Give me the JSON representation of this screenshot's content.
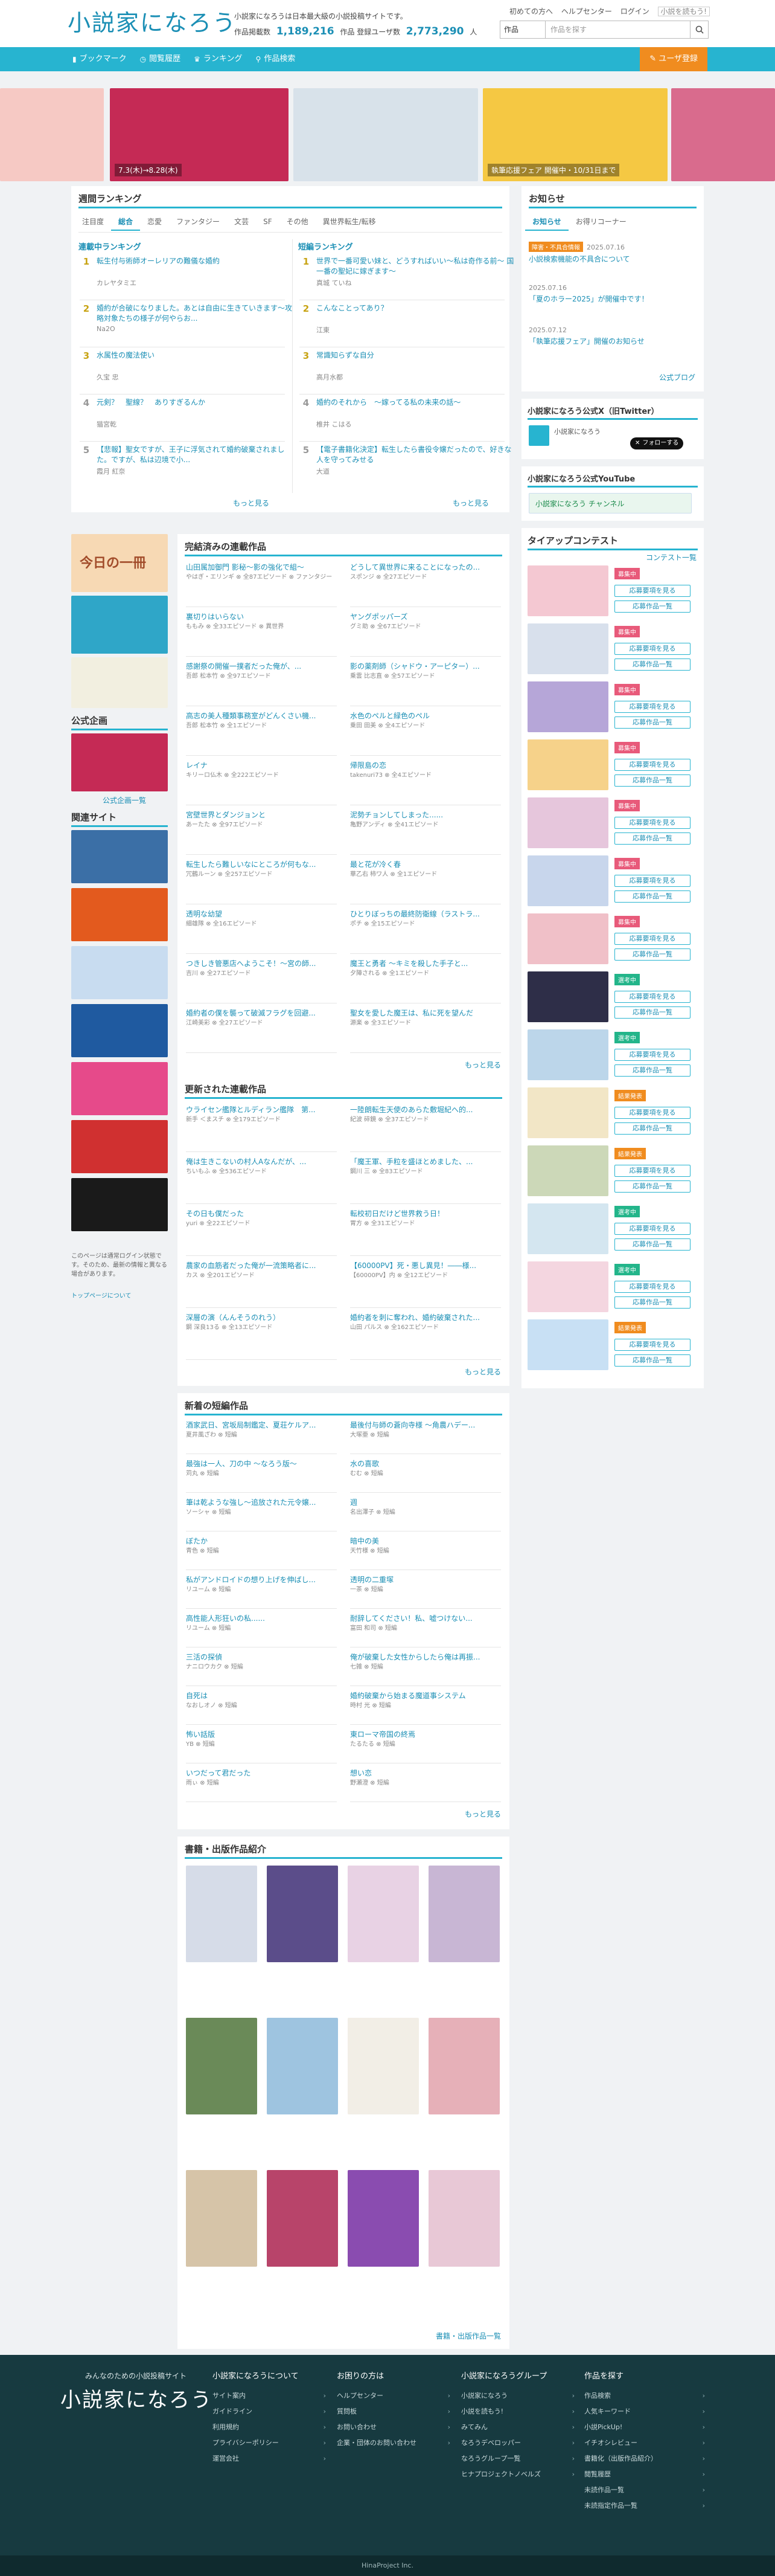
{
  "header": {
    "logo": "小説家になろう",
    "site_desc": "小説家になろうは日本最大級の小説投稿サイトです。",
    "stats_label_works": "作品掲載数",
    "stats_works": "1,189,216",
    "stats_label_users": "作品 登録ユーザ数",
    "stats_users": "2,773,290",
    "stats_unit": "人",
    "user_links": [
      "初めての方へ",
      "ヘルプセンター",
      "ログイン"
    ],
    "sub_logo": "小説を読もう!",
    "search_select": "作品",
    "search_placeholder": "作品を探す"
  },
  "nav": {
    "items": [
      "ブックマーク",
      "閲覧履歴",
      "ランキング",
      "作品検索"
    ],
    "register": "ユーザ登録"
  },
  "banners": [
    {
      "label": "",
      "color": "#f6c9c4"
    },
    {
      "label": "7.3(木)→8.28(木)",
      "color": "#c52a55"
    },
    {
      "label": "",
      "color": "#d8e2ea"
    },
    {
      "label": "執筆応援フェア 開催中・10/31日まで",
      "color": "#f5c843"
    },
    {
      "label": "",
      "color": "#f2efe0"
    },
    {
      "label": "",
      "color": "#d96b8d"
    }
  ],
  "ranking": {
    "title": "週間ランキング",
    "tabs": [
      "注目度",
      "総合",
      "恋愛",
      "ファンタジー",
      "文芸",
      "SF",
      "その他",
      "異世界転生/転移"
    ],
    "active_tab": 1,
    "col_left_title": "連載中ランキング",
    "col_right_title": "短編ランキング",
    "left": [
      {
        "no": "1",
        "title": "転生付与術師オーレリアの難儀な婚約",
        "author": "カレヤタミエ"
      },
      {
        "no": "2",
        "title": "婚約が合破になりました。あとは自由に生きていきます〜攻略対象たちの様子が何やらお...",
        "author": "Na2O"
      },
      {
        "no": "3",
        "title": "水属性の魔法使い",
        "author": "久宝 忠"
      },
      {
        "no": "4",
        "title": "元剣？　聖線？　ありすぎるんか",
        "author": "猫宮乾"
      },
      {
        "no": "5",
        "title": "【悲報】聖女ですが、王子に浮気されて婚約破棄されました。ですが、私は辺境で小...",
        "author": "霞月 紅奈"
      }
    ],
    "right": [
      {
        "no": "1",
        "title": "世界で一番可愛い妹と、どうすればいい〜私は奇作る前〜 国一番の聖妃に嫁ぎます〜",
        "author": "真城 ていね"
      },
      {
        "no": "2",
        "title": "こんなことってあり？",
        "author": "江東"
      },
      {
        "no": "3",
        "title": "常識知らずな自分",
        "author": "高月水都"
      },
      {
        "no": "4",
        "title": "婚約のそれから　〜嫁ってる私の未来の話〜",
        "author": "椎井 こはる"
      },
      {
        "no": "5",
        "title": "【電子書籍化決定】転生したら書役令嬢だったので、好きな人を守ってみせる",
        "author": "大道"
      }
    ],
    "more": "もっと見る"
  },
  "news": {
    "title": "お知らせ",
    "tabs": [
      "お知らせ",
      "お得リコーナー"
    ],
    "items": [
      {
        "date": "2025.07.16",
        "tag": "障害・不具合情報",
        "text": "小説検索機能の不具合について"
      },
      {
        "date": "2025.07.16",
        "tag": "",
        "text": "「夏のホラー2025」が開催中です！"
      },
      {
        "date": "2025.07.12",
        "tag": "",
        "text": "「執筆応援フェア」開催のお知らせ"
      }
    ],
    "more": "公式ブログ"
  },
  "twitter": {
    "title": "小説家になろう公式X（旧Twitter）",
    "account": "小説家になろう",
    "follow": "フォローする"
  },
  "youtube": {
    "title": "小説家になろう公式YouTube",
    "name": "小説家になろう チャンネル"
  },
  "tieup": {
    "title": "タイアップコンテスト",
    "list_link": "コンテスト一覧",
    "items": [
      {
        "status": "募集中",
        "color": "#e85a7a",
        "btn": "応募要項を見る",
        "btn2": "応募作品一覧"
      },
      {
        "status": "募集中",
        "color": "#e85a7a",
        "btn": "応募要項を見る",
        "btn2": "応募作品一覧"
      },
      {
        "status": "募集中",
        "color": "#e85a7a",
        "btn": "応募要項を見る",
        "btn2": "応募作品一覧"
      },
      {
        "status": "募集中",
        "color": "#e85a7a",
        "btn": "応募要項を見る",
        "btn2": "応募作品一覧"
      },
      {
        "status": "募集中",
        "color": "#e85a7a",
        "btn": "応募要項を見る",
        "btn2": "応募作品一覧"
      },
      {
        "status": "募集中",
        "color": "#e85a7a",
        "btn": "応募要項を見る",
        "btn2": "応募作品一覧"
      },
      {
        "status": "募集中",
        "color": "#e85a7a",
        "btn": "応募要項を見る",
        "btn2": "応募作品一覧"
      },
      {
        "status": "選考中",
        "color": "#23b58a",
        "btn": "応募要項を見る",
        "btn2": "応募作品一覧"
      },
      {
        "status": "選考中",
        "color": "#23b58a",
        "btn": "応募要項を見る",
        "btn2": "応募作品一覧"
      },
      {
        "status": "結果発表",
        "color": "#f08c1f",
        "btn": "応募要項を見る",
        "btn2": "応募作品一覧"
      },
      {
        "status": "結果発表",
        "color": "#f08c1f",
        "btn": "応募要項を見る",
        "btn2": "応募作品一覧"
      },
      {
        "status": "選考中",
        "color": "#23b58a",
        "btn": "応募要項を見る",
        "btn2": "応募作品一覧"
      },
      {
        "status": "選考中",
        "color": "#23b58a",
        "btn": "応募要項を見る",
        "btn2": "応募作品一覧"
      },
      {
        "status": "結果発表",
        "color": "#f08c1f",
        "btn": "応募要項を見る",
        "btn2": "応募作品一覧"
      }
    ]
  },
  "left_side": {
    "today_label": "今日の一冊",
    "official_title": "公式企画",
    "official_more": "公式企画一覧",
    "related_title": "関連サイト",
    "notice": "このページは通常ログイン状態です。そのため、最新の情報と異なる場合があります。",
    "notice_link": "トップページについて"
  },
  "completed": {
    "title": "完結済みの連載作品",
    "items": [
      {
        "title": "山田属加御門 影秘〜影の強化で組〜",
        "meta": "やはぎ・エリンギ ⊗ 全87エピソード ⊗ ファンタジー"
      },
      {
        "title": "どうして異世界に来ることになったの...",
        "meta": "スポンジ ⊗ 全27エピソード"
      },
      {
        "title": "裏切りはいらない",
        "meta": "ももみ ⊗ 全33エピソード ⊗ 異世界"
      },
      {
        "title": "ヤングポッパーズ",
        "meta": "グミ助 ⊗ 全67エピソード"
      },
      {
        "title": "感謝祭の開催一撲者だった俺が、...",
        "meta": "吾郎 松本竹 ⊗ 全97エピソード"
      },
      {
        "title": "影の薬剤師（シャドウ・アーピター）...",
        "meta": "乗雲 比志直 ⊗ 全57エピソード"
      },
      {
        "title": "高志の美人種類事務室がどんくさい機...",
        "meta": "吾郎 松本竹 ⊗ 全1エピソード"
      },
      {
        "title": "水色のペルと緑色のペル",
        "meta": "乗田 田美 ⊗ 全4エピソード"
      },
      {
        "title": "レイナ",
        "meta": "キリーロ仏木 ⊗ 全222エピソード"
      },
      {
        "title": "帰限島の恋",
        "meta": "takenuri73 ⊗ 全4エピソード"
      },
      {
        "title": "宮壁世界とダンジョンと",
        "meta": "あーたた ⊗ 全97エピソード"
      },
      {
        "title": "泥勢チョンしてしまった......",
        "meta": "亀野アンディ ⊗ 全41エピソード"
      },
      {
        "title": "転生したら難しいなにところが何もな...",
        "meta": "冗鶴ルーン ⊗ 全257エピソード"
      },
      {
        "title": "最と花が冷く春",
        "meta": "華乙右 柿ワ人 ⊗ 全1エピソード"
      },
      {
        "title": "透明な幼望",
        "meta": "細雄隊 ⊗ 全16エピソード"
      },
      {
        "title": "ひとりぼっちの最終防衛線（ラストラ...",
        "meta": "ポチ ⊗ 全15エピソード"
      },
      {
        "title": "つきしき管悪店へようこそ！〜宮の師...",
        "meta": "吉川 ⊗ 全27エピソード"
      },
      {
        "title": "魔王と勇者 〜キミを殺した手子と...",
        "meta": "夕陣される ⊗ 全1エピソード"
      },
      {
        "title": "婚約者の僕を襲って破滅フラグを回避...",
        "meta": "江崎美彩 ⊗ 全27エピソード"
      },
      {
        "title": "聖女を愛した魔王は、私に死を望んだ",
        "meta": "源楽 ⊗ 全3エピソード"
      }
    ],
    "more": "もっと見る"
  },
  "updated": {
    "title": "更新された連載作品",
    "items": [
      {
        "title": "ウライセン艦隊とルディラン艦隊　第...",
        "meta": "新手 ＜まスチ ⊗ 全179エピソード"
      },
      {
        "title": "一陸朗転生天使のあらた敷堀紀へ的...",
        "meta": "紀波 碎鏡 ⊗ 全37エピソード"
      },
      {
        "title": "俺は生きこないの村人Aなんだが、...",
        "meta": "ちいもふ ⊗ 全536エピソード"
      },
      {
        "title": "「魔王軍、手粒を盛ほとめました、...",
        "meta": "鋼川 三 ⊗ 全83エピソード"
      },
      {
        "title": "その日も僕だった",
        "meta": "yuri ⊗ 全22エピソード"
      },
      {
        "title": "転校初日だけど世界救う日！",
        "meta": "胃方 ⊗ 全31エピソード"
      },
      {
        "title": "農家の血筋者だった俺が一流策略者に...",
        "meta": "カス ⊗ 全201エピソード"
      },
      {
        "title": "【60000PV】死・悪し異見！――様...",
        "meta": "【60000PV】内 ⊗ 全12エピソード"
      },
      {
        "title": "深層の演（んんそうのれう）",
        "meta": "鋼 深良13る ⊗ 全13エピソード"
      },
      {
        "title": "婚約者を刺に奪われ、婚約破棄された...",
        "meta": "山田 パルス ⊗ 全162エピソード"
      }
    ],
    "more": "もっと見る"
  },
  "new_short": {
    "title": "新着の短編作品",
    "items": [
      {
        "title": "酒家武日、宮坂局制鑑定、夏荘ケルア...",
        "meta": "夏井風ざわ ⊗ 短編"
      },
      {
        "title": "最後付与師の蒼向寺様 〜角農ハデー...",
        "meta": "大塚亜 ⊗ 短編"
      },
      {
        "title": "最強は一人、刀の中 〜なろう版〜",
        "meta": "苅丸 ⊗ 短編"
      },
      {
        "title": "水の喜歌",
        "meta": "むむ ⊗ 短編"
      },
      {
        "title": "筆は乾ような強し〜追放された元令嬢...",
        "meta": "ソーシャ ⊗ 短編"
      },
      {
        "title": "週",
        "meta": "名出澤子 ⊗ 短編"
      },
      {
        "title": "ぼたか",
        "meta": "青色 ⊗ 短編"
      },
      {
        "title": "暗中の美",
        "meta": "天竹様 ⊗ 短編"
      },
      {
        "title": "私がアンドロイドの想り上げを伸ばし...",
        "meta": "リユーム ⊗ 短編"
      },
      {
        "title": "透明の二重塚",
        "meta": "一茶 ⊗ 短編"
      },
      {
        "title": "高性能人形狂いの私......",
        "meta": "リユーム ⊗ 短編"
      },
      {
        "title": "耐辞してください！私、嘘つけない...",
        "meta": "富田 和司 ⊗ 短編"
      },
      {
        "title": "三活の探偵",
        "meta": "ナニロウカク ⊗ 短編"
      },
      {
        "title": "俺が破棄した女性からしたら俺は再振...",
        "meta": "七雑 ⊗ 短編"
      },
      {
        "title": "自死は",
        "meta": "なおしオノ ⊗ 短編"
      },
      {
        "title": "婚約破棄から始まる魔道事システム",
        "meta": "時村 光 ⊗ 短編"
      },
      {
        "title": "怖い話版",
        "meta": "YB ⊗ 短編"
      },
      {
        "title": "東ローマ帝国の終焉",
        "meta": "たるたる ⊗ 短編"
      },
      {
        "title": "いつだって君だった",
        "meta": "雨ぃ ⊗ 短編"
      },
      {
        "title": "想い恋",
        "meta": "野瀬澄 ⊗ 短編"
      }
    ],
    "more": "もっと見る"
  },
  "books": {
    "title": "書籍・出版作品紹介",
    "items": [
      {
        "title": "",
        "color": "#d6dce8"
      },
      {
        "title": "",
        "color": "#5b4d8a"
      },
      {
        "title": "",
        "color": "#e8d2e4"
      },
      {
        "title": "",
        "color": "#c8b6d4"
      },
      {
        "title": "",
        "color": "#6a8a58"
      },
      {
        "title": "",
        "color": "#9ec4e0"
      },
      {
        "title": "",
        "color": "#f2eee6"
      },
      {
        "title": "",
        "color": "#e6b0b8"
      },
      {
        "title": "",
        "color": "#d6c4a8"
      },
      {
        "title": "",
        "color": "#b8446a"
      },
      {
        "title": "",
        "color": "#8a4cb0"
      },
      {
        "title": "",
        "color": "#e8c8d6"
      }
    ],
    "more": "書籍・出版作品一覧"
  },
  "footer": {
    "tagline": "みんなのための小説投稿サイト",
    "logo": "小説家になろう",
    "cols": [
      {
        "title": "小説家になろうについて",
        "links": [
          "サイト案内",
          "ガイドライン",
          "利用規約",
          "プライバシーポリシー",
          "運営会社"
        ]
      },
      {
        "title": "お困りの方は",
        "links": [
          "ヘルプセンター",
          "質問板",
          "お問い合わせ",
          "企業・団体のお問い合わせ"
        ]
      },
      {
        "title": "小説家になろうグループ",
        "links": [
          "小説家になろう",
          "小説を読もう!",
          "みてみん",
          "なろうデベロッパー",
          "なろうグループ一覧",
          "ヒナプロジェクトノベルズ"
        ]
      },
      {
        "title": "作品を探す",
        "links": [
          "作品検索",
          "人気キーワード",
          "小説PickUp!",
          "イチオシレビュー",
          "書籍化（出版作品紹介）",
          "閲覧履歴",
          "未読作品一覧",
          "未読指定作品一覧"
        ]
      }
    ],
    "copyright": "HinaProject Inc."
  }
}
